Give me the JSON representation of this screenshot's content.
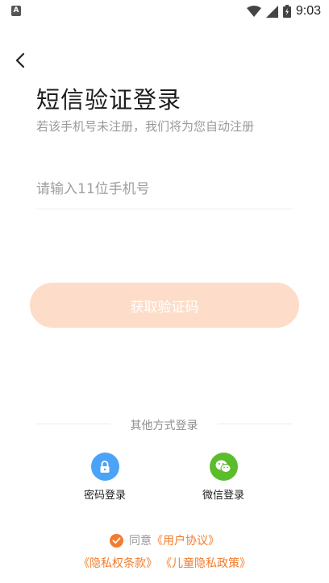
{
  "status_bar": {
    "left_icon_letter": "A",
    "time": "9:03",
    "icons": [
      "wifi-icon",
      "signal-icon",
      "battery-icon"
    ]
  },
  "header": {
    "back_icon": "chevron-left-icon"
  },
  "main": {
    "title": "短信验证登录",
    "subtitle": "若该手机号未注册，我们将为您自动注册",
    "phone_input": {
      "value": "",
      "placeholder": "请输入11位手机号"
    },
    "get_code_label": "获取验证码"
  },
  "other_methods": {
    "label": "其他方式登录",
    "options": [
      {
        "label": "密码登录",
        "icon": "lock-icon",
        "color": "#4ba3f7"
      },
      {
        "label": "微信登录",
        "icon": "wechat-icon",
        "color": "#5bbd2c"
      }
    ]
  },
  "agreement": {
    "agree_text": "同意",
    "user_agreement": "《用户协议》",
    "privacy_terms": "《隐私权条款》",
    "child_privacy": "《儿童隐私政策》"
  },
  "colors": {
    "accent": "#f47c2c",
    "button_disabled_bg": "#fdddc9"
  }
}
